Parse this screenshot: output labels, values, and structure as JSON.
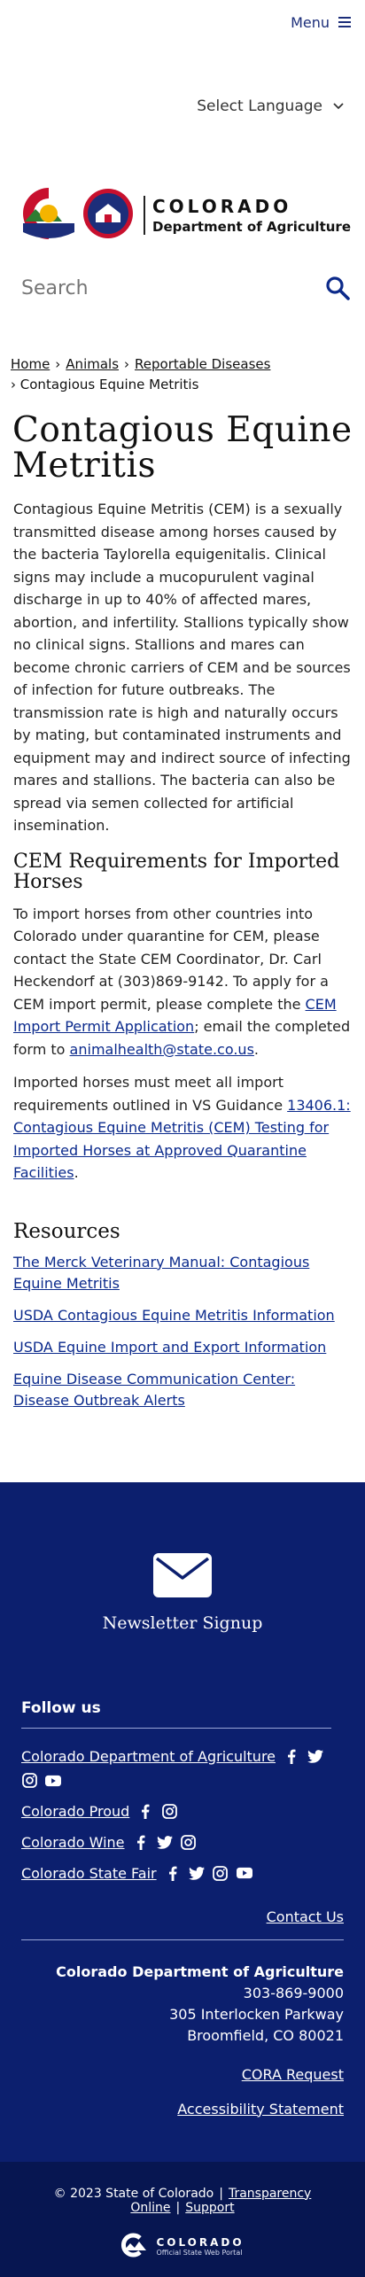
{
  "header": {
    "menu_label": "Menu",
    "language_label": "Select Language",
    "logo_title": "COLORADO",
    "logo_subtitle": "Department of Agriculture",
    "logo_badge": "CDA",
    "search_placeholder": "Search"
  },
  "breadcrumb": {
    "items": [
      "Home",
      "Animals",
      "Reportable Diseases"
    ],
    "current": "Contagious Equine Metritis",
    "separator": "›"
  },
  "page": {
    "title": "Contagious Equine Metritis",
    "intro": "Contagious Equine Metritis (CEM) is a sexually transmitted disease among horses caused by the bacteria Taylorella equigenitalis. Clinical signs may include a mucopurulent vaginal discharge in up to 40% of affected mares, abortion, and infertility. Stallions typically show no clinical signs. Stallions and mares can become chronic carriers of CEM and be sources of infection for future outbreaks. The transmission rate is high and naturally occurs by mating, but contaminated instruments and equipment may and indirect source of infecting mares and stallions. The bacteria can also be spread via semen collected for artificial insemination.",
    "section_title": "CEM Requirements for Imported Horses",
    "p2_part1": "To import horses from other countries into Colorado under quarantine for CEM, please contact the State CEM Coordinator, Dr. Carl Heckendorf at (303)869-9142. To apply for a CEM import permit, please complete the ",
    "p2_link1": "CEM Import Permit Application",
    "p2_part2": "; email the completed form to ",
    "p2_link2": "animalhealth@state.co.us",
    "p2_part3": ".",
    "p3_part1": "Imported horses must meet all import requirements outlined in VS Guidance ",
    "p3_link": "13406.1: Contagious Equine Metritis (CEM) Testing for Imported Horses at Approved Quarantine Facilities",
    "p3_part2": ".",
    "resources_title": "Resources",
    "resources": [
      "The Merck Veterinary Manual: Contagious Equine Metritis",
      "USDA Contagious Equine Metritis Information",
      "USDA Equine Import and Export Information",
      "Equine Disease Communication Center: Disease Outbreak Alerts"
    ]
  },
  "footer": {
    "newsletter_label": "Newsletter Signup",
    "follow_title": "Follow us",
    "follow_items": [
      "Colorado Department of Agriculture",
      "Colorado Proud",
      "Colorado Wine",
      "Colorado State Fair"
    ],
    "contact_label": "Contact Us",
    "address_org": "Colorado Department of Agriculture",
    "address_phone": "303-869-9000",
    "address_street": "305 Interlocken Parkway",
    "address_city": "Broomfield, CO 80021",
    "cora_label": "CORA Request",
    "accessibility_label": "Accessibility Statement",
    "copyright": "© 2023 State of Colorado",
    "transparency_label": "Transparency Online",
    "support_label": "Support",
    "copy_separator": "|",
    "portal_title": "COLORADO",
    "portal_subtitle": "Official State Web Portal"
  },
  "colors": {
    "footer_bg": "#0c1f6e",
    "bottom_bar_bg": "#071651",
    "link": "#0b2a8c",
    "brand_blue": "#1c2e7a",
    "logo_red": "#c8102e",
    "logo_gold": "#f4b400",
    "logo_green": "#2e7d32"
  }
}
